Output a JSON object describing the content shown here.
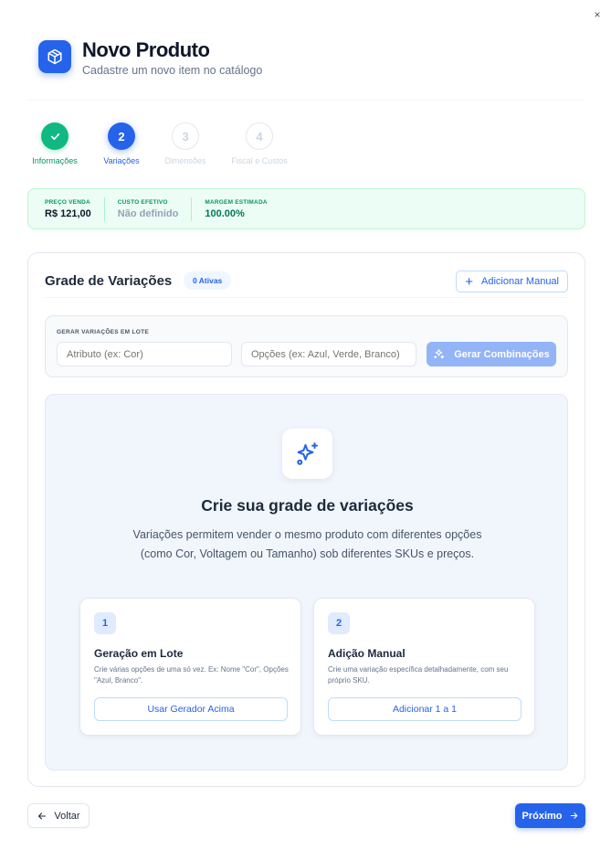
{
  "dialog": {
    "close_glyph": "×"
  },
  "header": {
    "icon": "package-icon",
    "title": "Novo Produto",
    "subtitle": "Cadastre um novo item no catálogo"
  },
  "stepper": {
    "steps": [
      {
        "number": "1",
        "label": "Informações",
        "state": "done",
        "icon": "check-icon"
      },
      {
        "number": "2",
        "label": "Variações",
        "state": "active"
      },
      {
        "number": "3",
        "label": "Dimensões",
        "state": "todo"
      },
      {
        "number": "4",
        "label": "Fiscal e Custos",
        "state": "todo"
      }
    ]
  },
  "summary": {
    "items": [
      {
        "label": "PREÇO VENDA",
        "value": "R$ 121,00",
        "color": "#0f172a"
      },
      {
        "label": "CUSTO EFETIVO",
        "value": "Não definido",
        "color": "#94a3b8"
      },
      {
        "label": "MARGEM ESTIMADA",
        "value": "100.00%",
        "color": "#047857"
      }
    ]
  },
  "variations": {
    "title": "Grade de Variações",
    "badge": "0 Ativas",
    "add_manual_label": "Adicionar Manual",
    "batch": {
      "label": "GERAR VARIAÇÕES EM LOTE",
      "attribute_placeholder": "Atributo (ex: Cor)",
      "options_placeholder": "Opções (ex: Azul, Verde, Branco)",
      "generate_label": "Gerar Combinações"
    },
    "empty": {
      "icon": "sparkles-icon",
      "title": "Crie sua grade de variações",
      "description": "Variações permitem vender o mesmo produto com diferentes opções (como Cor, Voltagem ou Tamanho) sob diferentes SKUs e preços.",
      "options": [
        {
          "number": "1",
          "title": "Geração em Lote",
          "description": "Crie várias opções de uma só vez. Ex: Nome \"Cor\", Opções \"Azul, Branco\".",
          "button": "Usar Gerador Acima"
        },
        {
          "number": "2",
          "title": "Adição Manual",
          "description": "Crie uma variação específica detalhadamente, com seu próprio SKU.",
          "button": "Adicionar 1 a 1"
        }
      ]
    }
  },
  "footer": {
    "back_label": "Voltar",
    "next_label": "Próximo"
  },
  "colors": {
    "primary": "#2563eb",
    "success": "#10b981",
    "summary_bg": "#ecfdf5"
  }
}
